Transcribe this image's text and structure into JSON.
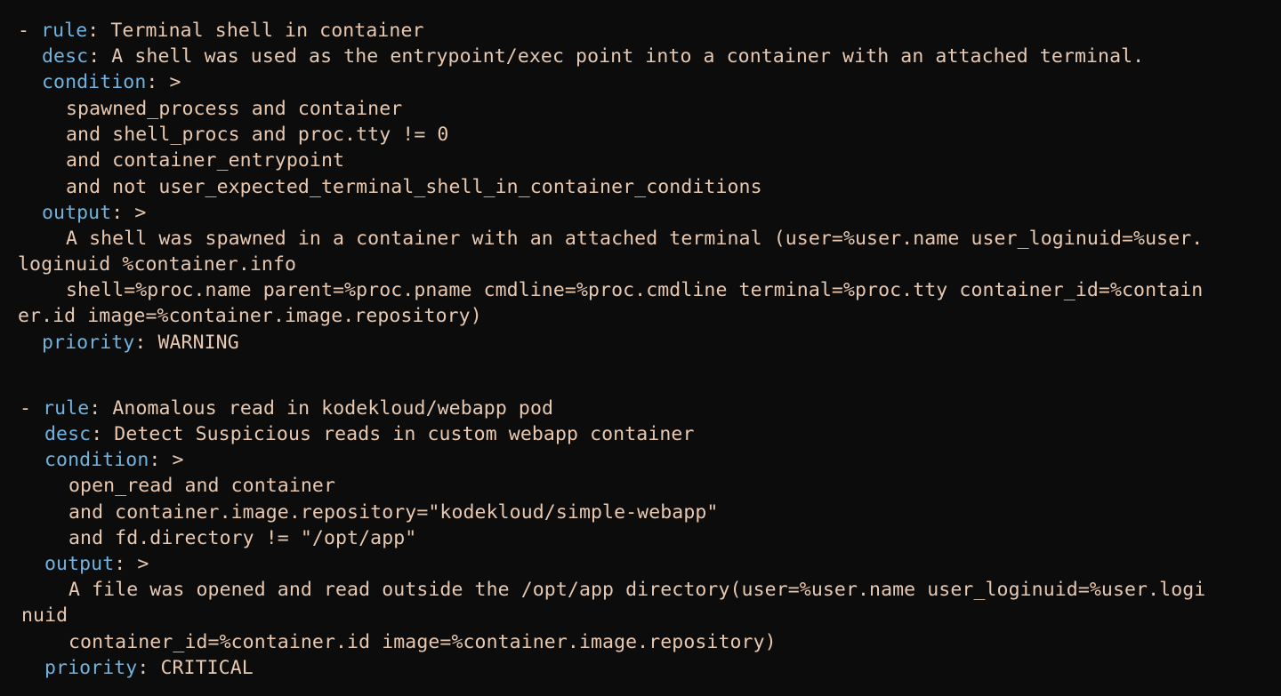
{
  "colors": {
    "background": "#0c0c0c",
    "key": "#6fb3e0",
    "text": "#e8c9b0"
  },
  "rules": [
    {
      "rule_key": "rule",
      "rule": "Terminal shell in container",
      "desc_key": "desc",
      "desc": "A shell was used as the entrypoint/exec point into a container with an attached terminal.",
      "condition_key": "condition",
      "condition_marker": ">",
      "condition_lines": [
        "spawned_process and container",
        "and shell_procs and proc.tty != 0",
        "and container_entrypoint",
        "and not user_expected_terminal_shell_in_container_conditions"
      ],
      "output_key": "output",
      "output_marker": ">",
      "output_lines": [
        "A shell was spawned in a container with an attached terminal (user=%user.name user_loginuid=%user.",
        "loginuid %container.info",
        "shell=%proc.name parent=%proc.pname cmdline=%proc.cmdline terminal=%proc.tty container_id=%contain",
        "er.id image=%container.image.repository)"
      ],
      "priority_key": "priority",
      "priority": "WARNING"
    },
    {
      "rule_key": "rule",
      "rule": "Anomalous read in kodekloud/webapp pod",
      "desc_key": "desc",
      "desc": "Detect Suspicious reads in custom webapp container",
      "condition_key": "condition",
      "condition_marker": ">",
      "condition_lines": [
        "open_read and container",
        "and container.image.repository=\"kodekloud/simple-webapp\"",
        "and fd.directory != \"/opt/app\""
      ],
      "output_key": "output",
      "output_marker": ">",
      "output_lines": [
        "A file was opened and read outside the /opt/app directory(user=%user.name user_loginuid=%user.logi",
        "nuid",
        "container_id=%container.id image=%container.image.repository)"
      ],
      "priority_key": "priority",
      "priority": "CRITICAL"
    }
  ]
}
